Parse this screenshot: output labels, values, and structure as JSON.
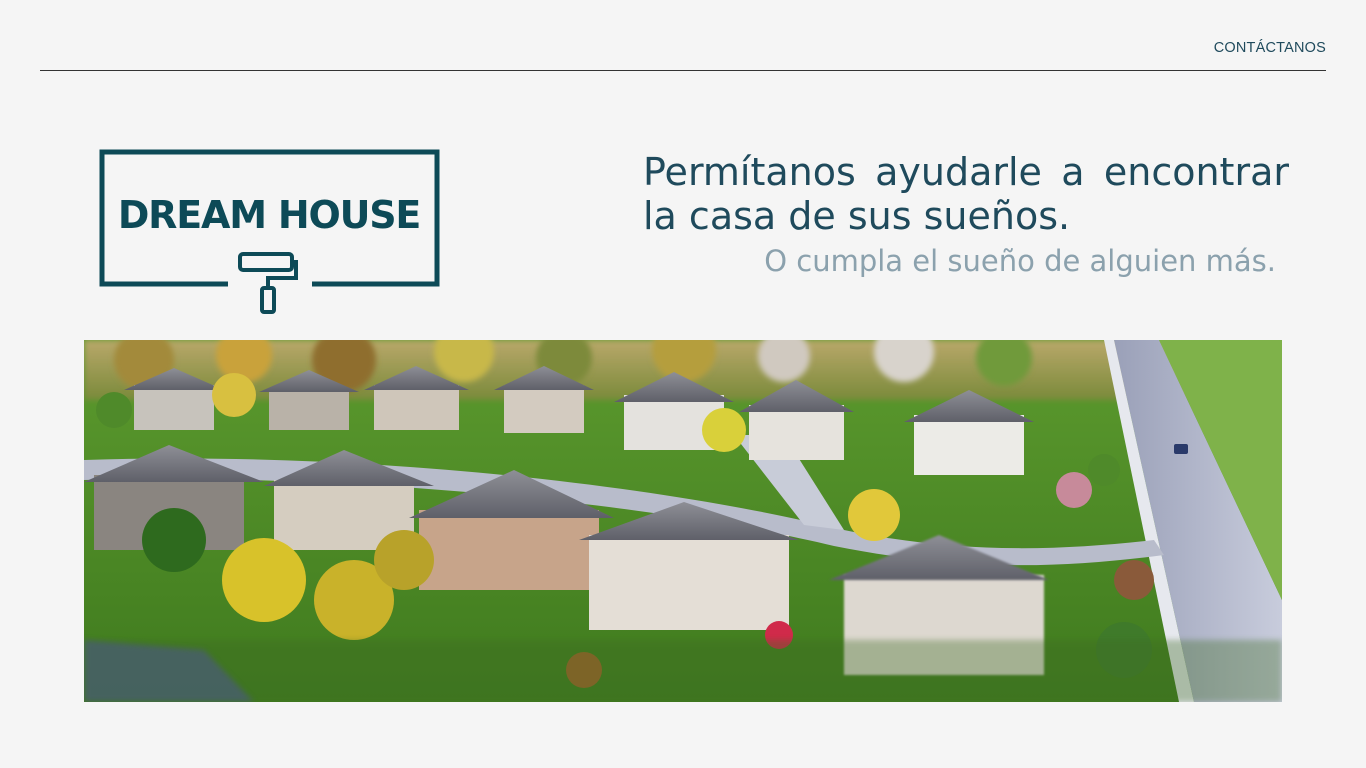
{
  "nav": {
    "contact_label": "CONTÁCTANOS"
  },
  "logo": {
    "text": "DREAM HOUSE",
    "color": "#0d4a57",
    "icon": "paint-roller-icon"
  },
  "hero": {
    "headline": "Permítanos ayudarle a encontrar la casa de sus sueños.",
    "subheadline": "O cumpla el sueño de alguien más."
  },
  "colors": {
    "background": "#f5f5f5",
    "headline": "#1f4a5c",
    "subheadline": "#8ba1ad",
    "divider": "#333333"
  }
}
